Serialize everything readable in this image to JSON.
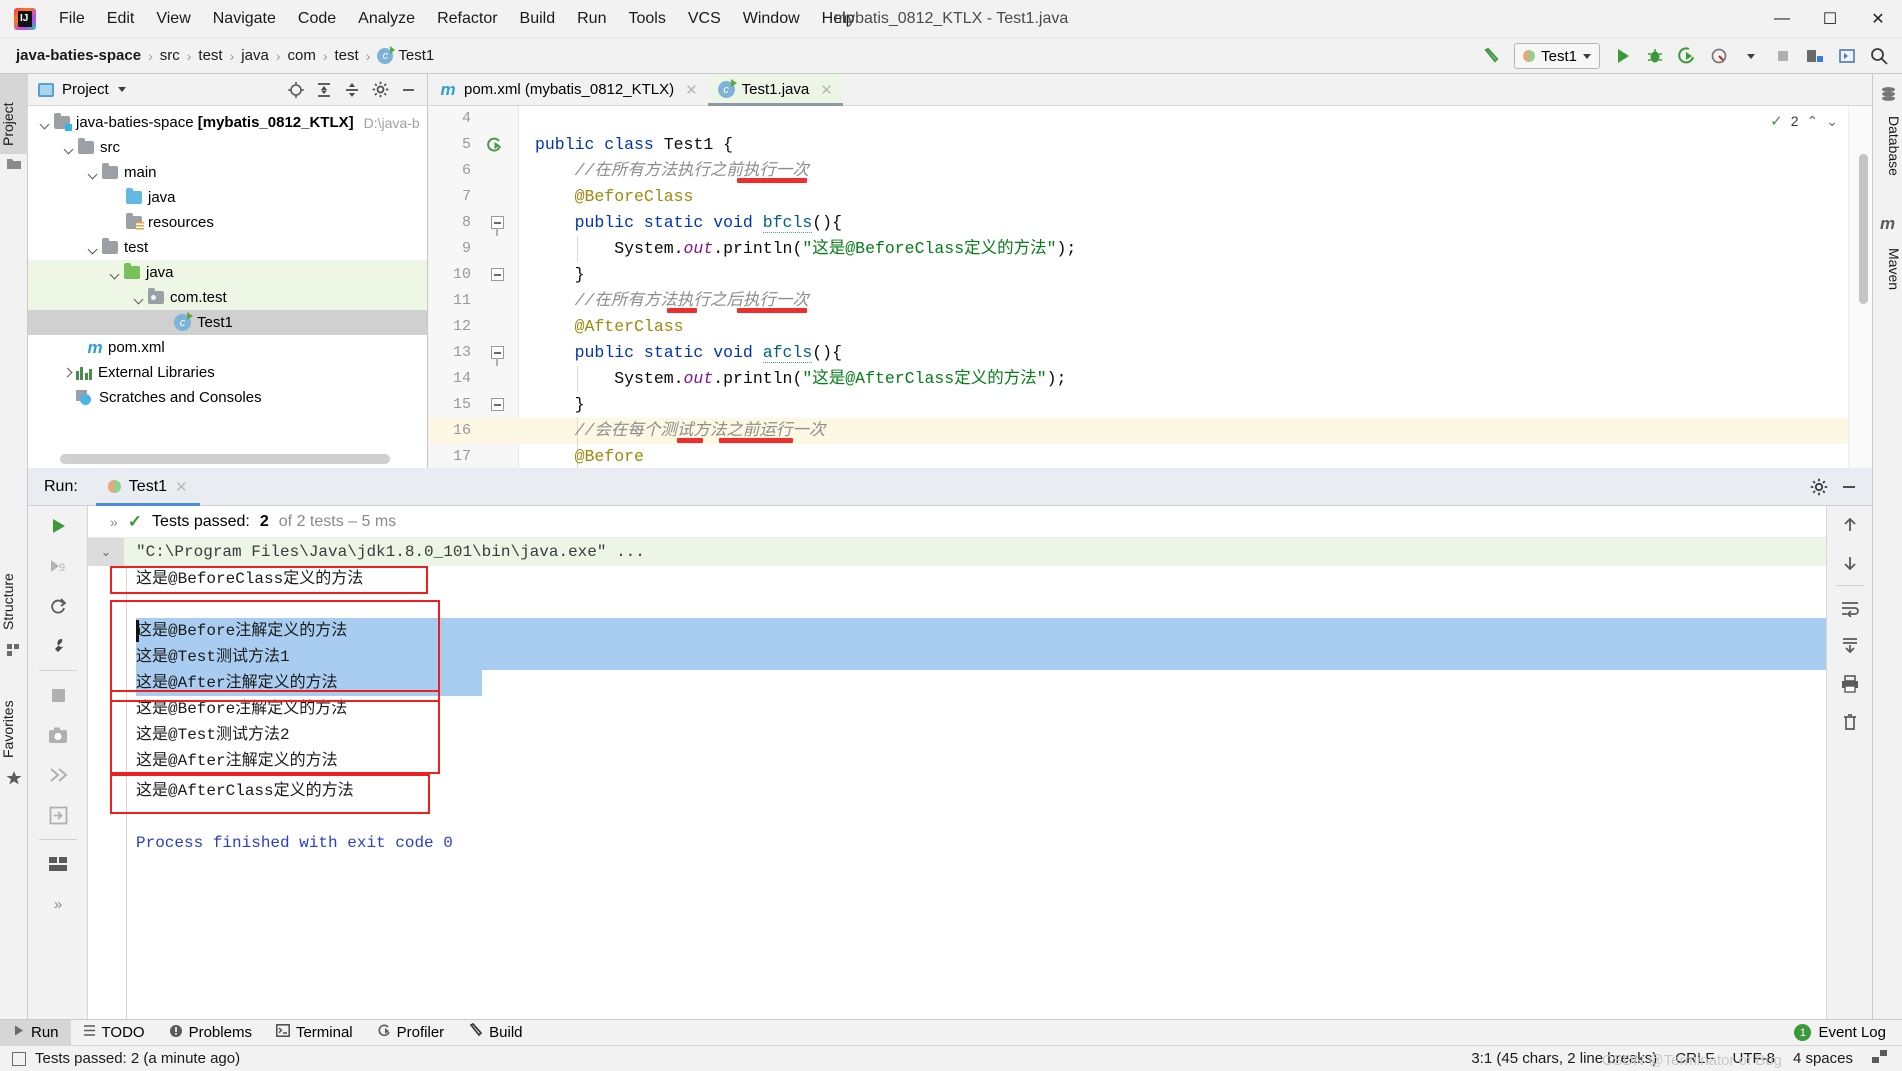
{
  "window": {
    "title": "mybatis_0812_KTLX - Test1.java",
    "minimize": "—",
    "maximize": "☐",
    "close": "✕"
  },
  "menubar": {
    "items": [
      "File",
      "Edit",
      "View",
      "Navigate",
      "Code",
      "Analyze",
      "Refactor",
      "Build",
      "Run",
      "Tools",
      "VCS",
      "Window",
      "Help"
    ]
  },
  "breadcrumb": {
    "items": [
      "java-baties-space",
      "src",
      "test",
      "java",
      "com",
      "test",
      "Test1"
    ],
    "separator": "›"
  },
  "run_config": {
    "name": "Test1"
  },
  "toolstrip_left": {
    "project": "Project",
    "structure": "Structure",
    "favorites": "Favorites"
  },
  "toolstrip_right": {
    "database": "Database",
    "maven": "Maven"
  },
  "project_panel": {
    "title": "Project",
    "tree": [
      {
        "label": "java-baties-space ",
        "bold": "[mybatis_0812_KTLX]",
        "path": "D:\\java-b",
        "indent": 0,
        "icon": "module-icon",
        "arrow": "down"
      },
      {
        "label": "src",
        "indent": 1,
        "icon": "folder-icon",
        "arrow": "down"
      },
      {
        "label": "main",
        "indent": 2,
        "icon": "folder-icon",
        "arrow": "down"
      },
      {
        "label": "java",
        "indent": 3,
        "icon": "source-folder-icon",
        "arrow": "none"
      },
      {
        "label": "resources",
        "indent": 3,
        "icon": "resources-folder-icon",
        "arrow": "none"
      },
      {
        "label": "test",
        "indent": 2,
        "icon": "folder-icon",
        "arrow": "down"
      },
      {
        "label": "java",
        "indent": 3,
        "icon": "test-source-folder-icon",
        "arrow": "down",
        "highlight": "green"
      },
      {
        "label": "com.test",
        "indent": 4,
        "icon": "package-icon",
        "arrow": "down",
        "highlight": "green"
      },
      {
        "label": "Test1",
        "indent": 5,
        "icon": "java-class-icon",
        "arrow": "none",
        "highlight": "selected"
      },
      {
        "label": "pom.xml",
        "indent": 2,
        "icon": "maven-icon",
        "arrow": "none"
      },
      {
        "label": "External Libraries",
        "indent": 1,
        "icon": "libraries-icon",
        "arrow": "right"
      },
      {
        "label": "Scratches and Consoles",
        "indent": 1,
        "icon": "scratches-icon",
        "arrow": "none"
      }
    ]
  },
  "editor": {
    "tabs": [
      {
        "label": "pom.xml (mybatis_0812_KTLX)",
        "icon": "maven-icon",
        "active": false
      },
      {
        "label": "Test1.java",
        "icon": "java-class-icon",
        "active": true
      }
    ],
    "inspection_count": "2",
    "lines": [
      {
        "num": "4",
        "tokens": []
      },
      {
        "num": "5",
        "tokens": [
          {
            "t": "public ",
            "c": "kw"
          },
          {
            "t": "class ",
            "c": "kw"
          },
          {
            "t": "Test1 {",
            "c": "pln"
          }
        ]
      },
      {
        "num": "6",
        "tokens": [
          {
            "t": "    //在所有方法执行之前执行一次",
            "c": "cmt"
          }
        ]
      },
      {
        "num": "7",
        "tokens": [
          {
            "t": "    @BeforeClass",
            "c": "ann"
          }
        ]
      },
      {
        "num": "8",
        "tokens": [
          {
            "t": "    ",
            "c": "pln"
          },
          {
            "t": "public static void ",
            "c": "kw"
          },
          {
            "t": "bfcls",
            "c": "fnu"
          },
          {
            "t": "(){",
            "c": "pln"
          }
        ]
      },
      {
        "num": "9",
        "tokens": [
          {
            "t": "        System.",
            "c": "pln"
          },
          {
            "t": "out",
            "c": "fld"
          },
          {
            "t": ".println(",
            "c": "pln"
          },
          {
            "t": "\"这是@BeforeClass定义的方法\"",
            "c": "str"
          },
          {
            "t": ");",
            "c": "pln"
          }
        ]
      },
      {
        "num": "10",
        "tokens": [
          {
            "t": "    }",
            "c": "pln"
          }
        ]
      },
      {
        "num": "11",
        "tokens": [
          {
            "t": "    //在所有方法执行之后执行一次",
            "c": "cmt"
          }
        ]
      },
      {
        "num": "12",
        "tokens": [
          {
            "t": "    @AfterClass",
            "c": "ann"
          }
        ]
      },
      {
        "num": "13",
        "tokens": [
          {
            "t": "    ",
            "c": "pln"
          },
          {
            "t": "public static void ",
            "c": "kw"
          },
          {
            "t": "afcls",
            "c": "fnu"
          },
          {
            "t": "(){",
            "c": "pln"
          }
        ]
      },
      {
        "num": "14",
        "tokens": [
          {
            "t": "        System.",
            "c": "pln"
          },
          {
            "t": "out",
            "c": "fld"
          },
          {
            "t": ".println(",
            "c": "pln"
          },
          {
            "t": "\"这是@AfterClass定义的方法\"",
            "c": "str"
          },
          {
            "t": ");",
            "c": "pln"
          }
        ]
      },
      {
        "num": "15",
        "tokens": [
          {
            "t": "    }",
            "c": "pln"
          }
        ]
      },
      {
        "num": "16",
        "tokens": [
          {
            "t": "    //会在每个测试方法之前运行一次",
            "c": "cmt"
          }
        ],
        "highlight": true
      },
      {
        "num": "17",
        "tokens": [
          {
            "t": "    @Before",
            "c": "ann"
          }
        ]
      }
    ]
  },
  "run_window": {
    "label": "Run:",
    "tab": "Test1",
    "test_status": {
      "prefix": "Tests passed:",
      "count": "2",
      "suffix": "of 2 tests – 5 ms"
    },
    "command": "\"C:\\Program Files\\Java\\jdk1.8.0_101\\bin\\java.exe\" ...",
    "output": [
      "这是@BeforeClass定义的方法",
      "这是@Before注解定义的方法",
      "这是@Test测试方法1",
      "这是@After注解定义的方法",
      "这是@Before注解定义的方法",
      "这是@Test测试方法2",
      "这是@After注解定义的方法",
      "这是@AfterClass定义的方法",
      "",
      "Process finished with exit code 0"
    ]
  },
  "bottom_bar": {
    "items": [
      {
        "label": "Run",
        "icon": "run-icon",
        "selected": true
      },
      {
        "label": "TODO",
        "icon": "todo-icon",
        "selected": false
      },
      {
        "label": "Problems",
        "icon": "problems-icon",
        "selected": false
      },
      {
        "label": "Terminal",
        "icon": "terminal-icon",
        "selected": false
      },
      {
        "label": "Profiler",
        "icon": "profiler-icon",
        "selected": false
      },
      {
        "label": "Build",
        "icon": "build-icon",
        "selected": false
      }
    ],
    "event_log": {
      "label": "Event Log",
      "count": "1"
    }
  },
  "status_bar": {
    "message": "Tests passed: 2 (a minute ago)",
    "caret": "3:1 (45 chars, 2 line breaks)",
    "line_sep": "CRLF",
    "encoding": "UTF-8",
    "indent": "4 spaces",
    "watermark": "CSDN @Terminator of Bug"
  },
  "colors": {
    "accent_blue": "#4a90d9",
    "annotation": "#9e880d",
    "keyword": "#0033b3",
    "string": "#067d17",
    "highlight_red": "#f01f1f",
    "selection": "#a9cdf0"
  }
}
